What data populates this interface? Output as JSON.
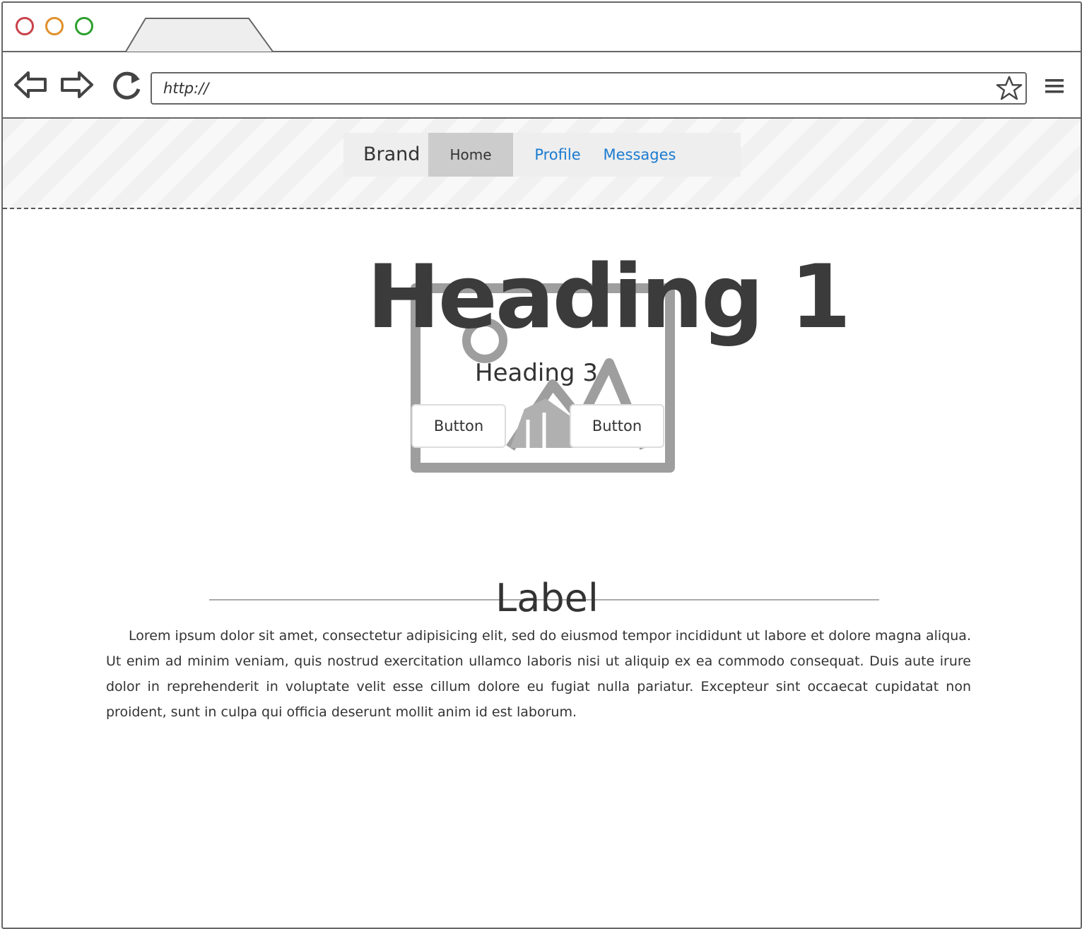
{
  "browser": {
    "url": "http://",
    "traffic_lights": [
      {
        "name": "close",
        "color": "#c9424a"
      },
      {
        "name": "minimize",
        "color": "#e0902a"
      },
      {
        "name": "maximize",
        "color": "#2ca02c"
      }
    ],
    "icons": [
      "back-arrow-icon",
      "forward-arrow-icon",
      "reload-icon",
      "star-icon",
      "hamburger-menu-icon"
    ]
  },
  "navbar": {
    "brand": "Brand",
    "items": [
      {
        "label": "Home",
        "active": true
      },
      {
        "label": "Profile",
        "active": false
      },
      {
        "label": "Messages",
        "active": false
      }
    ],
    "link_color": "#1a7bd0",
    "active_bg": "#cccccc"
  },
  "hero": {
    "heading1": "Heading 1",
    "heading3": "Heading 3",
    "buttons": [
      {
        "label": "Button"
      },
      {
        "label": "Button"
      }
    ],
    "image_icon": "image-placeholder-icon"
  },
  "section": {
    "label": "Label",
    "paragraph": "Lorem ipsum dolor sit amet, consectetur adipisicing elit, sed do eiusmod tempor incididunt ut labore et dolore magna aliqua. Ut enim ad minim veniam, quis nostrud exercitation ullamco laboris nisi ut aliquip ex ea commodo consequat. Duis aute irure dolor in reprehenderit in voluptate velit esse cillum dolore eu fugiat nulla pariatur. Excepteur sint occaecat cupidatat non proident, sunt in culpa qui officia deserunt mollit anim id est laborum."
  }
}
